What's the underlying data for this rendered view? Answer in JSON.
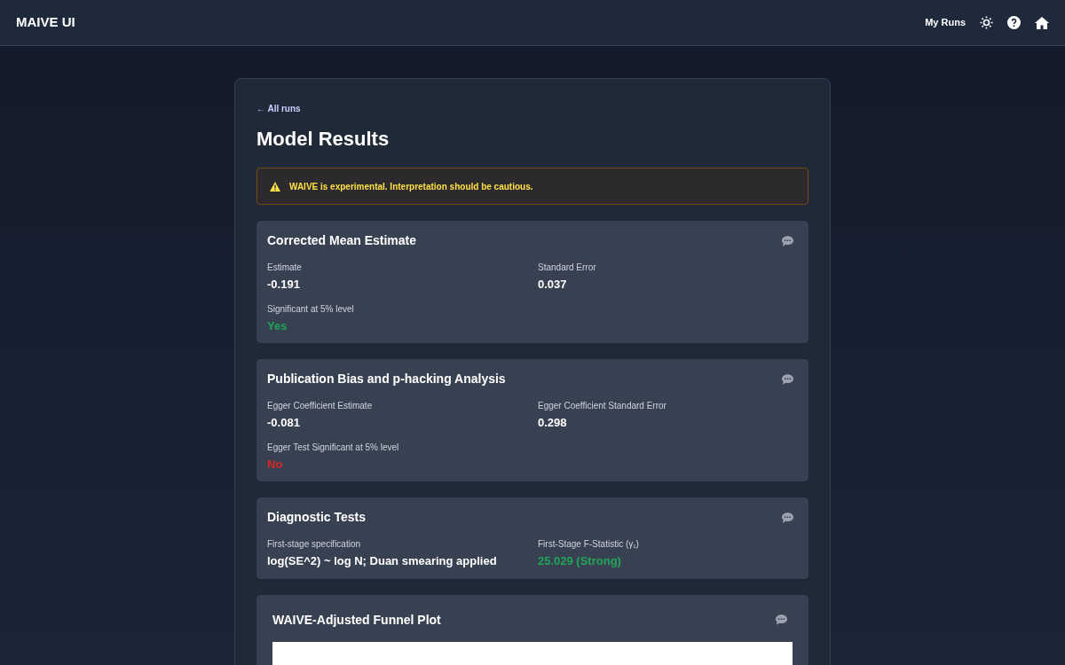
{
  "header": {
    "title": "MAIVE UI",
    "nav_link": "My Runs"
  },
  "back_link": "← All runs",
  "page_title": "Model Results",
  "warning": "WAIVE is experimental. Interpretation should be cautious.",
  "cards": [
    {
      "title": "Corrected Mean Estimate",
      "fields": [
        {
          "label": "Estimate",
          "value": "-0.191",
          "color": "#ffffff"
        },
        {
          "label": "Standard Error",
          "value": "0.037",
          "color": "#ffffff"
        },
        {
          "label": "Significant at 5% level",
          "value": "Yes",
          "color": "#22a559"
        }
      ]
    },
    {
      "title": "Publication Bias and p-hacking Analysis",
      "fields": [
        {
          "label": "Egger Coefficient Estimate",
          "value": "-0.081",
          "color": "#ffffff"
        },
        {
          "label": "Egger Coefficient Standard Error",
          "value": "0.298",
          "color": "#ffffff"
        },
        {
          "label": "Egger Test Significant at 5% level",
          "value": "No",
          "color": "#dc2626"
        }
      ]
    },
    {
      "title": "Diagnostic Tests",
      "fields": [
        {
          "label": "First-stage specification",
          "value": "log(SE^2) ~ log N; Duan smearing applied",
          "color": "#ffffff"
        },
        {
          "label": "First-Stage F-Statistic (γ₁)",
          "value": "25.029 (Strong)",
          "color": "#22a559"
        }
      ]
    }
  ],
  "plot_card": {
    "title": "WAIVE-Adjusted Funnel Plot"
  }
}
